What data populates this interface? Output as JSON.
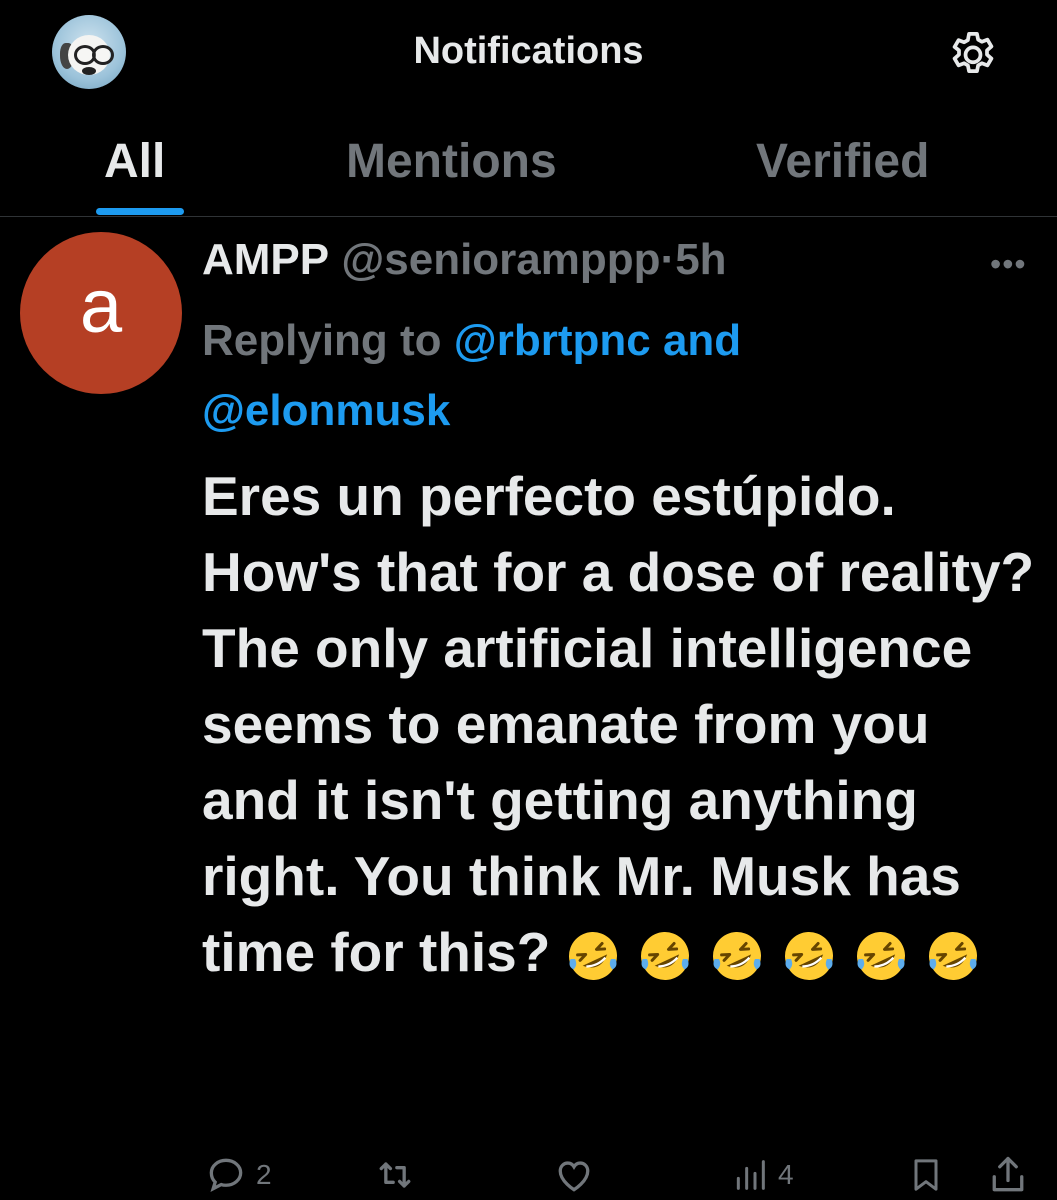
{
  "header": {
    "title": "Notifications",
    "avatar_icon": "profile-avatar",
    "settings_icon": "gear-icon"
  },
  "tabs": [
    {
      "label": "All",
      "active": true
    },
    {
      "label": "Mentions",
      "active": false
    },
    {
      "label": "Verified",
      "active": false
    }
  ],
  "tweet": {
    "avatar_letter": "a",
    "avatar_color": "#b53f24",
    "name": "AMPP",
    "handle": "@senioramppp",
    "separator": "·",
    "time": "5h",
    "more_icon": "more-dots-icon",
    "replying_prefix": "Replying to",
    "mention_1": "@rbrtpnc",
    "mention_join": "and",
    "mention_2": "@elonmusk",
    "text": "Eres un perfecto estúpido. How's that for a dose of reality? The only artificial intelligence seems to emanate from you and it isn't getting anything right. You think Mr. Musk has time for this?",
    "emoji": "rolling-on-floor-laughing",
    "emoji_count": 6
  },
  "actions": {
    "reply_count": "2",
    "retweet_count": "",
    "like_count": "",
    "views_count": "4"
  },
  "colors": {
    "background": "#000000",
    "text": "#e7e9ea",
    "muted": "#71767b",
    "accent": "#1d9bf0",
    "divider": "#2f3336"
  }
}
